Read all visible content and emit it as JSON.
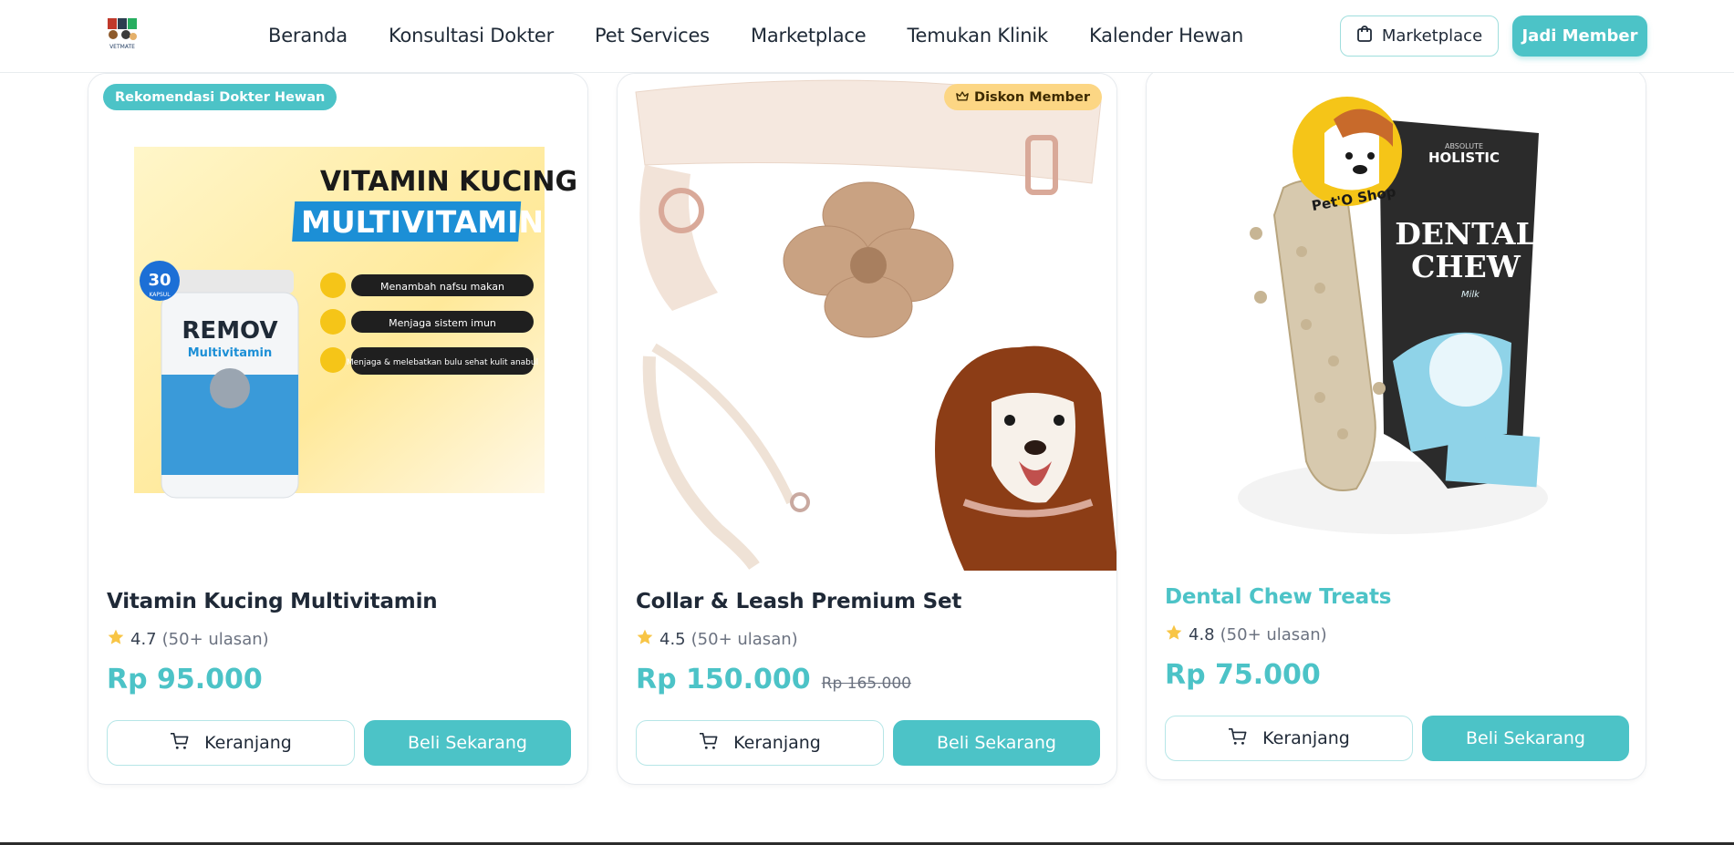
{
  "header": {
    "logo_text": "VETMATE",
    "nav": [
      "Beranda",
      "Konsultasi Dokter",
      "Pet Services",
      "Marketplace",
      "Temukan Klinik",
      "Kalender Hewan"
    ],
    "marketplace_btn": "Marketplace",
    "member_btn": "Jadi Member"
  },
  "colors": {
    "accent": "#4cc3c7",
    "badge_gold": "#fcd684",
    "text": "#1f2937"
  },
  "products": [
    {
      "badge": "Rekomendasi Dokter Hewan",
      "badge_icon": "",
      "image_texts": [
        "VITAMIN KUCING",
        "MULTIVITAMIN",
        "REMOV",
        "Multivitamin",
        "30",
        "KAPSUL",
        "Menambah nafsu makan",
        "Menjaga sistem imun",
        "Menjaga & melebatkan bulu sehat kulit anabul"
      ],
      "name": "Vitamin Kucing Multivitamin",
      "rating": "4.7",
      "reviews": "(50+ ulasan)",
      "price": "Rp 95.000",
      "old_price": "",
      "cart_label": "Keranjang",
      "buy_label": "Beli Sekarang"
    },
    {
      "badge": "Diskon Member",
      "badge_icon": "crown-icon",
      "image_texts": [],
      "name": "Collar & Leash Premium Set",
      "rating": "4.5",
      "reviews": "(50+ ulasan)",
      "price": "Rp 150.000",
      "old_price": "Rp 165.000",
      "cart_label": "Keranjang",
      "buy_label": "Beli Sekarang"
    },
    {
      "badge": "",
      "badge_icon": "",
      "image_texts": [
        "Pet'O Shop",
        "ABSOLUTE",
        "HOLISTIC",
        "DENTAL",
        "CHEW",
        "Milk"
      ],
      "name": "Dental Chew Treats",
      "rating": "4.8",
      "reviews": "(50+ ulasan)",
      "price": "Rp 75.000",
      "old_price": "",
      "cart_label": "Keranjang",
      "buy_label": "Beli Sekarang"
    }
  ]
}
